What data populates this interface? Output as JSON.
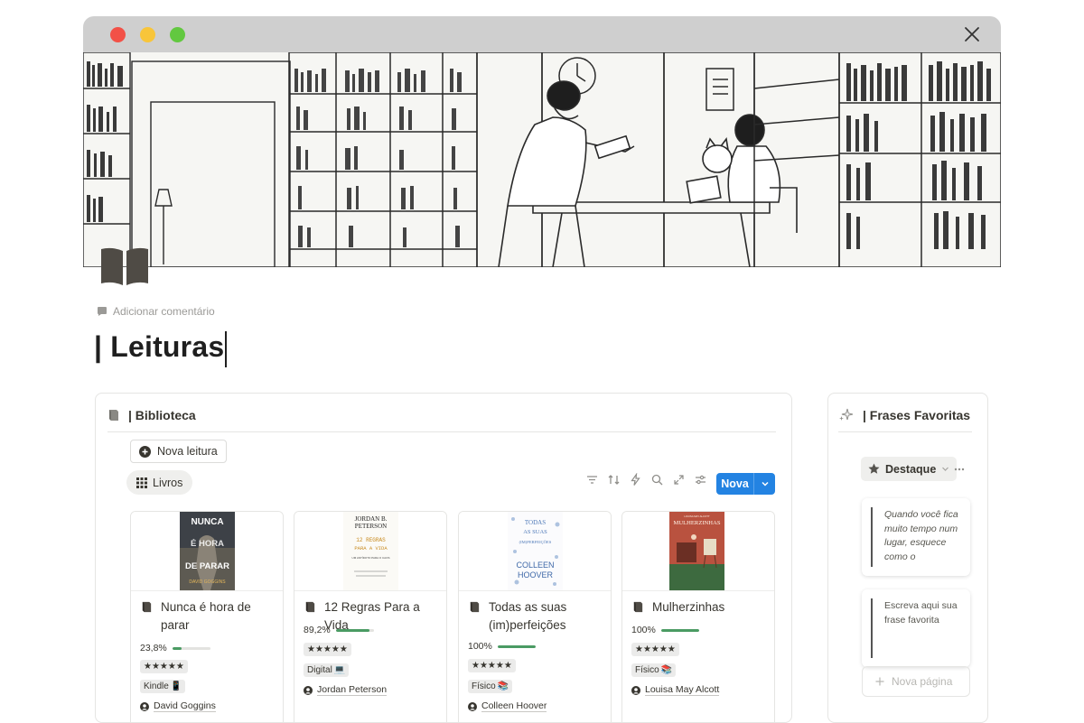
{
  "window": {
    "controls": [
      "close-dot",
      "minimize-dot",
      "maximize-dot"
    ]
  },
  "comment": {
    "label": "Adicionar comentário"
  },
  "page": {
    "title": "| Leituras"
  },
  "library": {
    "title": "| Biblioteca",
    "new_button": "Nova leitura",
    "view_tab": "Livros",
    "new_label": "Nova",
    "cards": [
      {
        "title": "Nunca é hora de parar",
        "progress_label": "23,8%",
        "progress": 0.238,
        "rating": "★★★★★",
        "format": "Kindle",
        "format_emoji": "📱",
        "author": "David Goggins",
        "cover_lines": [
          "NUNCA",
          "É HORA",
          "DE PARAR",
          "DAVID GOGGINS"
        ]
      },
      {
        "title": "12 Regras Para a Vida",
        "progress_label": "89,2%",
        "progress": 0.892,
        "rating": "★★★★★",
        "format": "Digital",
        "format_emoji": "💻",
        "author": "Jordan Peterson",
        "cover_lines": [
          "JORDAN B.",
          "PETERSON",
          "12 REGRAS",
          "PARA A VIDA",
          "UM ANTÍDOTO PARA O CAOS"
        ]
      },
      {
        "title": "Todas as suas (im)perfeições",
        "progress_label": "100%",
        "progress": 1.0,
        "rating": "★★★★★",
        "format": "Físico",
        "format_emoji": "📚",
        "author": "Colleen Hoover",
        "cover_lines": [
          "TODAS",
          "AS SUAS",
          "(IM)PERFEIÇÕES",
          "COLLEEN",
          "HOOVER"
        ]
      },
      {
        "title": "Mulherzinhas",
        "progress_label": "100%",
        "progress": 1.0,
        "rating": "★★★★★",
        "format": "Físico",
        "format_emoji": "📚",
        "author": "Louisa May Alcott",
        "cover_lines": [
          "MULHERZINHAS",
          "LOUISA MAY ALCOTT"
        ]
      }
    ]
  },
  "favorites": {
    "title": "| Frases Favoritas",
    "filter_label": "Destaque",
    "quotes": [
      {
        "text": "Quando você fica muito tempo num lugar, esquece como o"
      },
      {
        "text": "Escreva aqui sua frase favorita"
      }
    ],
    "new_page": "Nova página"
  },
  "colors": {
    "accent": "#2383e2",
    "progress": "#4a9b63"
  },
  "icons": [
    "close-icon",
    "book-icon",
    "comment-icon",
    "plus-circle-icon",
    "grid-icon",
    "filter-icon",
    "sort-icon",
    "lightning-icon",
    "search-icon",
    "expand-icon",
    "settings-icon",
    "chevron-down-icon",
    "sparkles-icon",
    "star-icon",
    "more-icon",
    "user-icon",
    "plus-icon"
  ]
}
